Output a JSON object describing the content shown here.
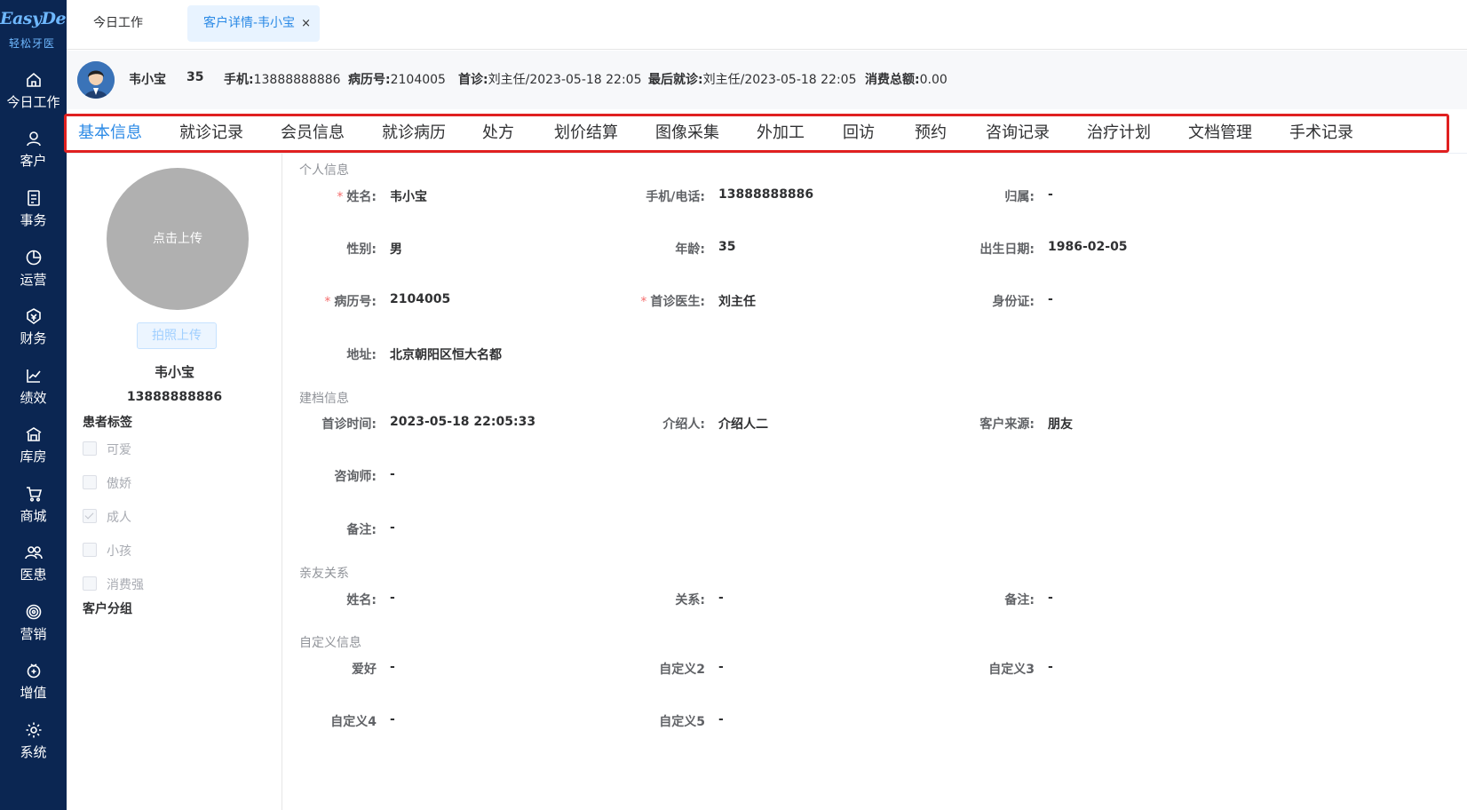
{
  "sidebar": {
    "logo_text": "EasyDent",
    "logo_sub": "轻松牙医",
    "items": [
      {
        "label": "今日工作",
        "icon": "home-icon"
      },
      {
        "label": "客户",
        "icon": "user-icon"
      },
      {
        "label": "事务",
        "icon": "document-icon"
      },
      {
        "label": "运营",
        "icon": "pie-chart-icon"
      },
      {
        "label": "财务",
        "icon": "finance-icon"
      },
      {
        "label": "绩效",
        "icon": "trend-chart-icon"
      },
      {
        "label": "库房",
        "icon": "warehouse-icon"
      },
      {
        "label": "商城",
        "icon": "shopping-cart-icon"
      },
      {
        "label": "医患",
        "icon": "users-icon"
      },
      {
        "label": "营销",
        "icon": "target-icon"
      },
      {
        "label": "增值",
        "icon": "value-added-icon"
      },
      {
        "label": "系统",
        "icon": "gear-icon"
      }
    ]
  },
  "top_tabs": {
    "today": "今日工作",
    "customer_detail": "客户详情-韦小宝",
    "close": "×"
  },
  "patient": {
    "name": "韦小宝",
    "age": "35",
    "phone_label": "手机:",
    "phone": "13888888886",
    "record_label": "病历号:",
    "record_no": "2104005",
    "first_visit_label": "首诊:",
    "first_visit": "刘主任/2023-05-18 22:05",
    "last_visit_label": "最后就诊:",
    "last_visit": "刘主任/2023-05-18 22:05",
    "total_label": "消费总额:",
    "total": "0.00"
  },
  "func_tabs": [
    "基本信息",
    "就诊记录",
    "会员信息",
    "就诊病历",
    "处方",
    "划价结算",
    "图像采集",
    "外加工",
    "回访",
    "预约",
    "咨询记录",
    "治疗计划",
    "文档管理",
    "手术记录"
  ],
  "left_panel": {
    "upload_text": "点击上传",
    "photo_btn": "拍照上传",
    "name": "韦小宝",
    "phone": "13888888886",
    "tags_title": "患者标签",
    "tags": [
      {
        "label": "可爱",
        "checked": false
      },
      {
        "label": "傲娇",
        "checked": false
      },
      {
        "label": "成人",
        "checked": true
      },
      {
        "label": "小孩",
        "checked": false
      },
      {
        "label": "消费强",
        "checked": false
      }
    ],
    "group_title": "客户分组"
  },
  "sections": {
    "personal": "个人信息",
    "archive": "建档信息",
    "relatives": "亲友关系",
    "custom": "自定义信息"
  },
  "fields": {
    "name_label": "姓名:",
    "name": "韦小宝",
    "phone_label": "手机/电话:",
    "phone": "13888888886",
    "belong_label": "归属:",
    "belong": "-",
    "gender_label": "性别:",
    "gender": "男",
    "age_label": "年龄:",
    "age": "35",
    "birthday_label": "出生日期:",
    "birthday": "1986-02-05",
    "record_label": "病历号:",
    "record": "2104005",
    "doctor_label": "首诊医生:",
    "doctor": "刘主任",
    "id_label": "身份证:",
    "id": "-",
    "address_label": "地址:",
    "address": "北京朝阳区恒大名都",
    "first_time_label": "首诊时间:",
    "first_time": "2023-05-18 22:05:33",
    "referrer_label": "介绍人:",
    "referrer": "介绍人二",
    "source_label": "客户来源:",
    "source": "朋友",
    "consultant_label": "咨询师:",
    "consultant": "-",
    "remark_label": "备注:",
    "remark": "-",
    "rel_name_label": "姓名:",
    "rel_name": "-",
    "rel_relation_label": "关系:",
    "rel_relation": "-",
    "rel_remark_label": "备注:",
    "rel_remark": "-",
    "hobby_label": "爱好",
    "hobby": "-",
    "custom2_label": "自定义2",
    "custom2": "-",
    "custom3_label": "自定义3",
    "custom3": "-",
    "custom4_label": "自定义4",
    "custom4": "-",
    "custom5_label": "自定义5",
    "custom5": "-"
  },
  "colors": {
    "sidebar_bg": "#0b2652",
    "accent": "#2b8ae6",
    "highlight_border": "#e02020",
    "required": "#f56c6c"
  }
}
